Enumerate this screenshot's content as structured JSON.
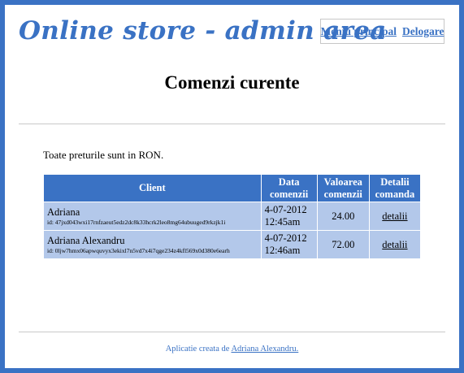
{
  "header": {
    "site_title": "Online store - admin area",
    "nav": {
      "main_menu": "Meniu principal",
      "logout": "Delogare"
    }
  },
  "page": {
    "title": "Comenzi curente",
    "currency_note": "Toate preturile sunt in RON."
  },
  "orders_table": {
    "headers": {
      "client": "Client",
      "date_line1": "Data",
      "date_line2": "comenzii",
      "value_line1": "Valoarea",
      "value_line2": "comenzii",
      "details_line1": "Detalii",
      "details_line2": "comanda"
    },
    "rows": [
      {
        "client_name": "Adriana",
        "client_id": "id: 47jxd043wxi17rnfzaeut5edz2dc8k33hcrk2leo8mg64ubuuged9rkzjk1i",
        "date_line1": "4-07-2012",
        "date_line2": "12:45am",
        "value": "24.00",
        "details_link": "detalii"
      },
      {
        "client_name": "Adriana Alexandru",
        "client_id": "id: 0ljw7hmx06apwquvyx3ekixl7n5vd7x4i7qge234z4kfl569x0d380e6earh",
        "date_line1": "4-07-2012",
        "date_line2": "12:46am",
        "value": "72.00",
        "details_link": "detalii"
      }
    ]
  },
  "footer": {
    "prefix": "Aplicatie creata de ",
    "author_link": "Adriana Alexandru."
  },
  "colors": {
    "accent": "#3a72c4",
    "table_row": "#b3c8ea"
  }
}
